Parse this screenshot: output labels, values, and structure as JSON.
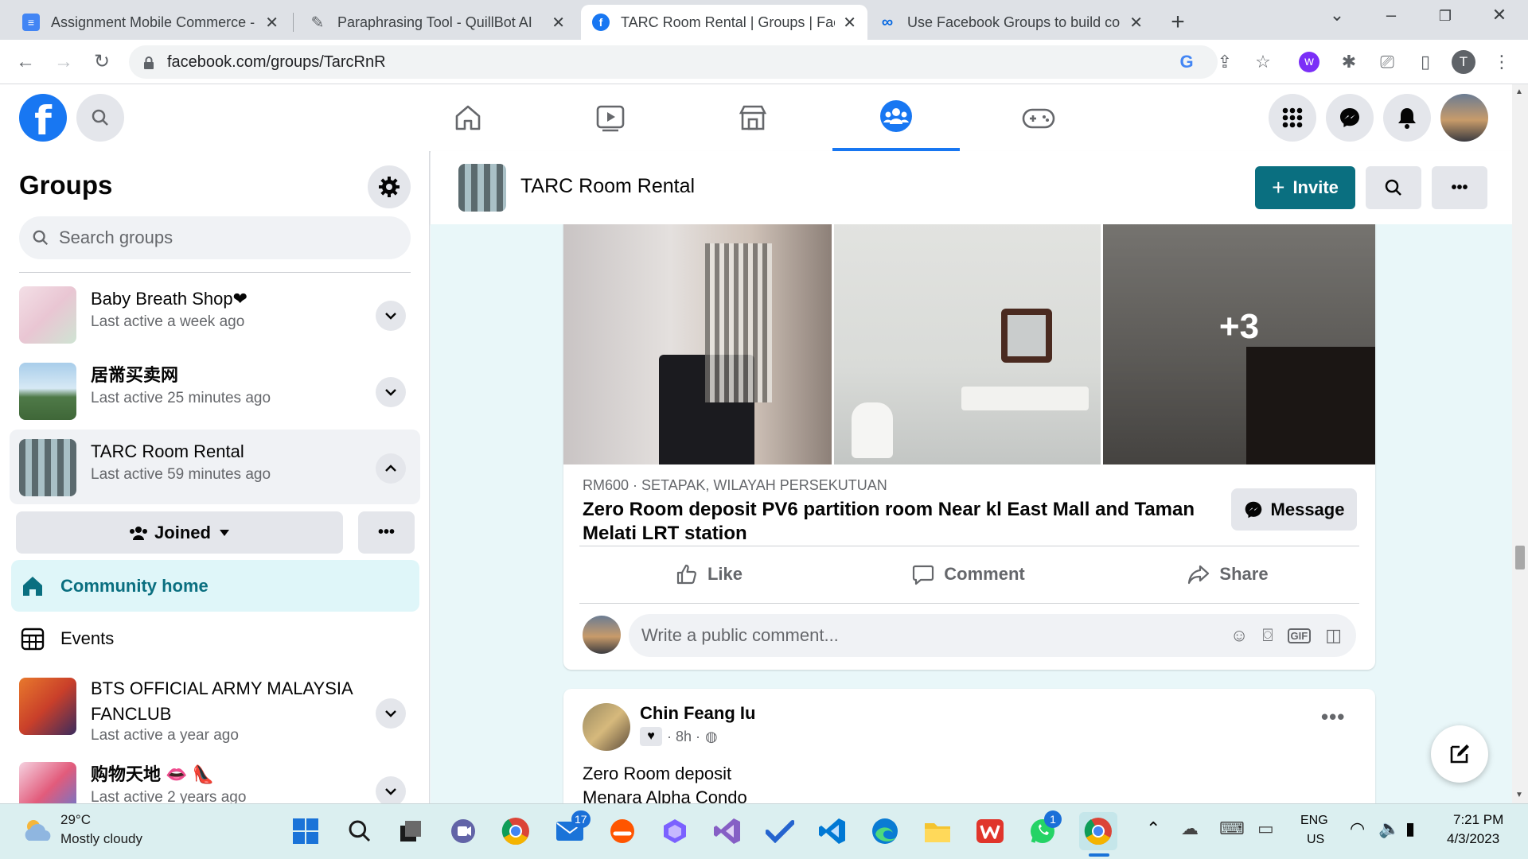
{
  "browser": {
    "tabs": [
      {
        "title": "Assignment Mobile Commerce -",
        "icon": "docs-icon",
        "active": false
      },
      {
        "title": "Paraphrasing Tool - QuillBot AI",
        "icon": "quillbot-icon",
        "active": false
      },
      {
        "title": "TARC Room Rental | Groups | Fac",
        "icon": "facebook-icon",
        "active": true
      },
      {
        "title": "Use Facebook Groups to build co",
        "icon": "meta-icon",
        "active": false
      }
    ],
    "url": "facebook.com/groups/TarcRnR",
    "profile_initial": "T"
  },
  "sidebar": {
    "title": "Groups",
    "search_placeholder": "Search groups",
    "groups": [
      {
        "name": "Baby Breath Shop❤",
        "last_active": "Last active a week ago"
      },
      {
        "name": "居黹买卖网",
        "last_active": "Last active 25 minutes ago"
      },
      {
        "name": "TARC Room Rental",
        "last_active": "Last active 59 minutes ago"
      }
    ],
    "joined_label": "Joined",
    "community_home": "Community home",
    "events": "Events",
    "more_groups": [
      {
        "name": "BTS OFFICIAL ARMY MALAYSIA FANCLUB",
        "last_active": "Last active a year ago"
      },
      {
        "name": "购物天地 👄 👠",
        "last_active": "Last active 2 years ago"
      }
    ]
  },
  "group_header": {
    "name": "TARC Room Rental",
    "invite_label": "Invite"
  },
  "listing_post": {
    "more_photos": "+3",
    "meta": "RM600 · SETAPAK, WILAYAH PERSEKUTUAN",
    "title": "Zero Room deposit PV6 partition room Near kl East Mall and Taman Melati LRT station",
    "message_label": "Message",
    "like_label": "Like",
    "comment_label": "Comment",
    "share_label": "Share",
    "comment_placeholder": "Write a public comment..."
  },
  "second_post": {
    "author": "Chin Feang Iu",
    "time": "· 8h ·",
    "body_line1": "Zero Room deposit",
    "body_line2": "Menara Alpha Condo"
  },
  "taskbar": {
    "weather_temp": "29°C",
    "weather_desc": "Mostly cloudy",
    "mail_badge": "17",
    "whatsapp_badge": "1",
    "lang_line1": "ENG",
    "lang_line2": "US",
    "time": "7:21 PM",
    "date": "4/3/2023"
  }
}
